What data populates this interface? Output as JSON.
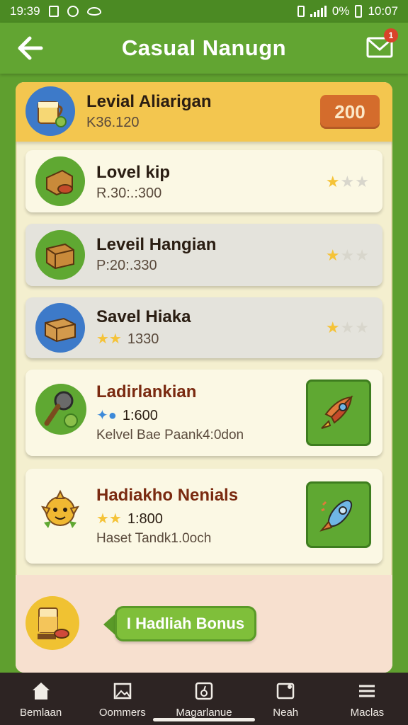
{
  "status_bar": {
    "time": "19:39",
    "battery": "0%",
    "clock": "10:07"
  },
  "header": {
    "title": "Casual Nanugn",
    "mail_badge": "1"
  },
  "featured": {
    "name": "Levial Aliarigan",
    "sub": "K36.120",
    "points": "200"
  },
  "items": [
    {
      "name": "Lovel kip",
      "sub": "R.30:.:300",
      "stars_on": 1,
      "stars_total": 3
    },
    {
      "name": "Leveil Hangian",
      "sub": "P:20:.330",
      "stars_on": 1,
      "stars_total": 3
    },
    {
      "name": "Savel Hiaka",
      "sub": "1330",
      "stars_on": 1,
      "stars_total": 3
    }
  ],
  "reward_cards": [
    {
      "name": "Ladirlankian",
      "value": "1:600",
      "desc": "Kelvel Bae Paank4:0don"
    },
    {
      "name": "Hadiakho Nenials",
      "value": "1:800",
      "desc": "Haset Tandk1.0och"
    }
  ],
  "bonus": {
    "label": "I Hadliah Bonus"
  },
  "nav": [
    {
      "label": "Bemlaan",
      "icon": "home-icon"
    },
    {
      "label": "Oommers",
      "icon": "image-icon"
    },
    {
      "label": "Magarlanue",
      "icon": "bag-icon"
    },
    {
      "label": "Neah",
      "icon": "notes-icon"
    },
    {
      "label": "Maclas",
      "icon": "menu-icon"
    }
  ],
  "colors": {
    "header": "#62a532",
    "featured": "#f3c64f",
    "points": "#d46c2c",
    "nav": "#2d2423"
  }
}
